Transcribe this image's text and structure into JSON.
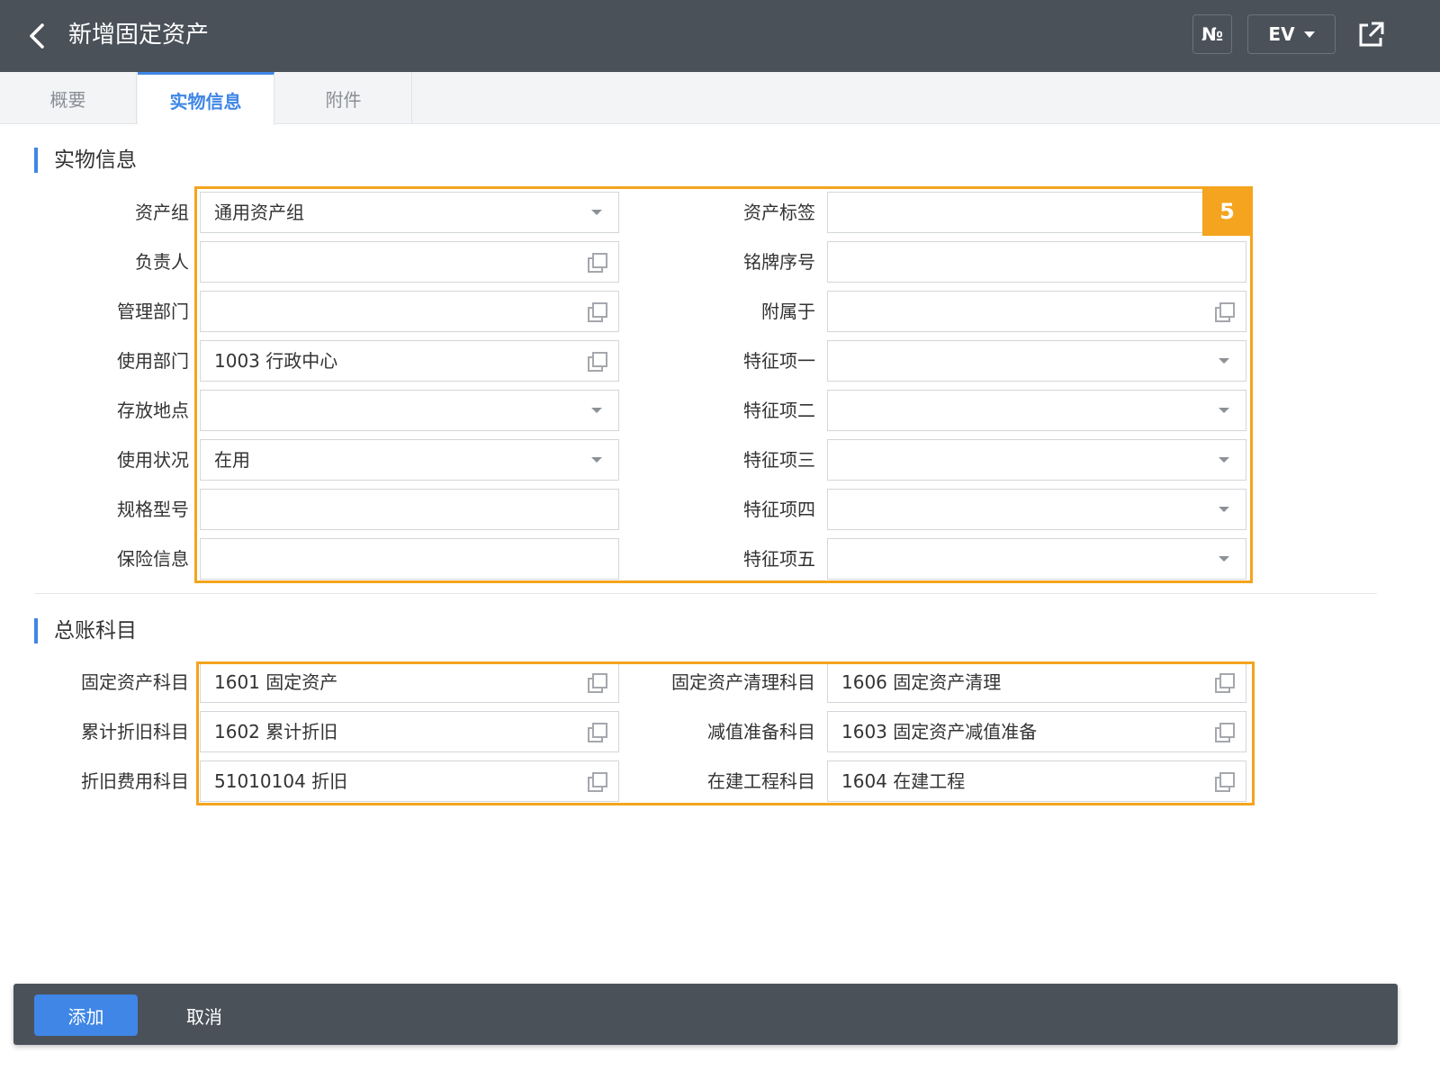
{
  "header": {
    "title": "新增固定资产",
    "number_label": "№",
    "ev_label": "EV"
  },
  "tabs": [
    {
      "label": "概要"
    },
    {
      "label": "实物信息"
    },
    {
      "label": "附件"
    }
  ],
  "physical": {
    "section_title": "实物信息",
    "badge": "5",
    "left": [
      {
        "label": "资产组",
        "value": "通用资产组",
        "control": "dropdown"
      },
      {
        "label": "负责人",
        "value": "",
        "control": "reference"
      },
      {
        "label": "管理部门",
        "value": "",
        "control": "reference"
      },
      {
        "label": "使用部门",
        "value": "1003 行政中心",
        "control": "reference"
      },
      {
        "label": "存放地点",
        "value": "",
        "control": "dropdown"
      },
      {
        "label": "使用状况",
        "value": "在用",
        "control": "dropdown"
      },
      {
        "label": "规格型号",
        "value": "",
        "control": "text"
      },
      {
        "label": "保险信息",
        "value": "",
        "control": "text"
      }
    ],
    "right": [
      {
        "label": "资产标签",
        "value": "",
        "control": "text"
      },
      {
        "label": "铭牌序号",
        "value": "",
        "control": "text"
      },
      {
        "label": "附属于",
        "value": "",
        "control": "reference"
      },
      {
        "label": "特征项一",
        "value": "",
        "control": "dropdown"
      },
      {
        "label": "特征项二",
        "value": "",
        "control": "dropdown"
      },
      {
        "label": "特征项三",
        "value": "",
        "control": "dropdown"
      },
      {
        "label": "特征项四",
        "value": "",
        "control": "dropdown"
      },
      {
        "label": "特征项五",
        "value": "",
        "control": "dropdown"
      }
    ]
  },
  "ledger": {
    "section_title": "总账科目",
    "left": [
      {
        "label": "固定资产科目",
        "value": "1601 固定资产",
        "control": "reference"
      },
      {
        "label": "累计折旧科目",
        "value": "1602 累计折旧",
        "control": "reference"
      },
      {
        "label": "折旧费用科目",
        "value": "51010104 折旧",
        "control": "reference"
      }
    ],
    "right": [
      {
        "label": "固定资产清理科目",
        "value": "1606 固定资产清理",
        "control": "reference"
      },
      {
        "label": "减值准备科目",
        "value": "1603 固定资产减值准备",
        "control": "reference"
      },
      {
        "label": "在建工程科目",
        "value": "1604 在建工程",
        "control": "reference"
      }
    ]
  },
  "footer": {
    "add_label": "添加",
    "cancel_label": "取消"
  },
  "colors": {
    "header_bg": "#4a5159",
    "accent": "#3f86e6",
    "highlight": "#f4a41e"
  }
}
